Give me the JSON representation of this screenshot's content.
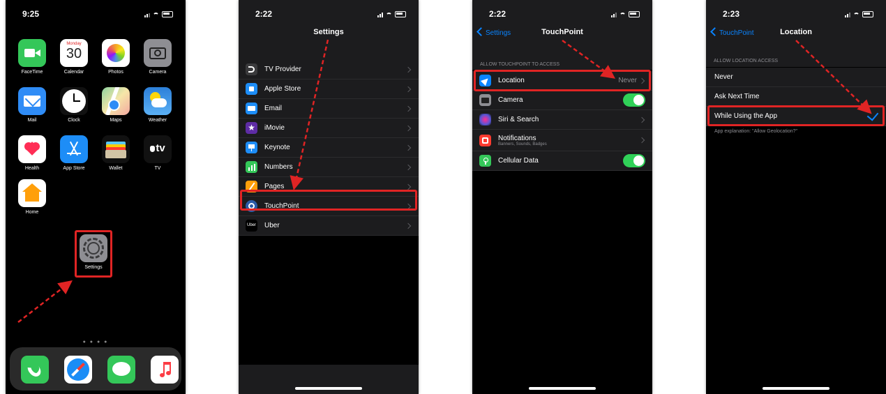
{
  "colors": {
    "accent": "#0a84ff",
    "highlight": "#e02424",
    "toggle_on": "#30d158"
  },
  "screen1": {
    "time": "9:25",
    "apps": [
      {
        "name": "FaceTime",
        "icon": "facetime-icon"
      },
      {
        "name": "Calendar",
        "icon": "calendar-icon",
        "day": "Monday",
        "date": "30"
      },
      {
        "name": "Photos",
        "icon": "photos-icon"
      },
      {
        "name": "Camera",
        "icon": "camera-icon"
      },
      {
        "name": "Mail",
        "icon": "mail-icon"
      },
      {
        "name": "Clock",
        "icon": "clock-icon"
      },
      {
        "name": "Maps",
        "icon": "maps-icon"
      },
      {
        "name": "Weather",
        "icon": "weather-icon"
      },
      {
        "name": "Health",
        "icon": "health-icon"
      },
      {
        "name": "App Store",
        "icon": "app-store-icon"
      },
      {
        "name": "Wallet",
        "icon": "wallet-icon"
      },
      {
        "name": "TV",
        "icon": "tv-icon",
        "glyph": "tv"
      },
      {
        "name": "Home",
        "icon": "home-icon"
      },
      {
        "name": "Settings",
        "icon": "settings-gear-icon"
      }
    ],
    "dock": [
      {
        "icon": "phone-icon"
      },
      {
        "icon": "safari-icon"
      },
      {
        "icon": "messages-icon"
      },
      {
        "icon": "music-icon"
      }
    ],
    "page_dots": "● ● ● ●"
  },
  "screen2": {
    "time": "2:22",
    "title": "Settings",
    "items": [
      {
        "label": "TV Provider",
        "icon": "tv-provider-icon"
      },
      {
        "label": "Apple Store",
        "icon": "apple-store-icon"
      },
      {
        "label": "Email",
        "icon": "email-icon"
      },
      {
        "label": "iMovie",
        "icon": "imovie-icon"
      },
      {
        "label": "Keynote",
        "icon": "keynote-icon"
      },
      {
        "label": "Numbers",
        "icon": "numbers-icon"
      },
      {
        "label": "Pages",
        "icon": "pages-icon"
      },
      {
        "label": "TouchPoint",
        "icon": "touchpoint-icon"
      },
      {
        "label": "Uber",
        "icon": "uber-icon",
        "glyph": "Uber"
      }
    ]
  },
  "screen3": {
    "time": "2:22",
    "back": "Settings",
    "title": "TouchPoint",
    "section": "ALLOW TOUCHPOINT TO ACCESS",
    "items": [
      {
        "label": "Location",
        "value": "Never",
        "icon": "location-arrow-icon"
      },
      {
        "label": "Camera",
        "icon": "camera-icon",
        "toggle": true
      },
      {
        "label": "Siri & Search",
        "icon": "siri-icon"
      },
      {
        "label": "Notifications",
        "sublabel": "Banners, Sounds, Badges",
        "icon": "notifications-icon"
      },
      {
        "label": "Cellular Data",
        "icon": "cellular-data-icon",
        "toggle": true
      }
    ]
  },
  "screen4": {
    "time": "2:23",
    "back": "TouchPoint",
    "title": "Location",
    "section": "ALLOW LOCATION ACCESS",
    "options": [
      "Never",
      "Ask Next Time",
      "While Using the App"
    ],
    "selected": "While Using the App",
    "footer": "App explanation: \"Allow Geolocation?\""
  }
}
